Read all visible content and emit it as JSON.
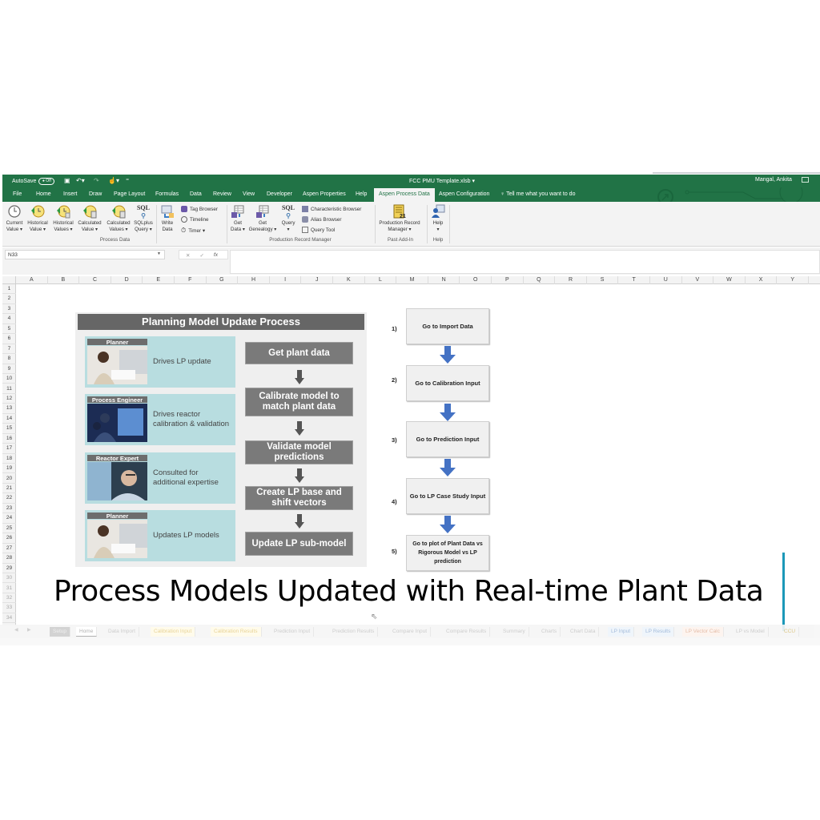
{
  "window": {
    "autosave_label": "AutoSave",
    "autosave_state": "Off",
    "document_title": "FCC PMU Template.xlsb",
    "user_name": "Mangal, Ankita"
  },
  "menu_tabs": [
    {
      "label": "File"
    },
    {
      "label": "Home"
    },
    {
      "label": "Insert"
    },
    {
      "label": "Draw"
    },
    {
      "label": "Page Layout"
    },
    {
      "label": "Formulas"
    },
    {
      "label": "Data"
    },
    {
      "label": "Review"
    },
    {
      "label": "View"
    },
    {
      "label": "Developer"
    },
    {
      "label": "Aspen Properties"
    },
    {
      "label": "Help"
    },
    {
      "label": "Aspen Process Data",
      "active": true
    },
    {
      "label": "Aspen Configuration"
    },
    {
      "label": "Tell me what you want to do"
    }
  ],
  "ribbon": {
    "process_data": {
      "group_label": "Process Data",
      "buttons": [
        {
          "line1": "Current",
          "line2": "Value ▾"
        },
        {
          "line1": "Historical",
          "line2": "Value ▾"
        },
        {
          "line1": "Historical",
          "line2": "Values ▾"
        },
        {
          "line1": "Calculated",
          "line2": "Value ▾"
        },
        {
          "line1": "Calculated",
          "line2": "Values ▾"
        },
        {
          "line1": "SQLplus",
          "line2": "Query ▾"
        },
        {
          "line1": "Write",
          "line2": "Data"
        }
      ],
      "small_buttons": [
        {
          "label": "Tag Browser"
        },
        {
          "label": "Timeline"
        },
        {
          "label": "Timer ▾"
        }
      ]
    },
    "production_record_manager": {
      "group_label": "Production Record Manager",
      "buttons": [
        {
          "line1": "Get",
          "line2": "Data ▾"
        },
        {
          "line1": "Get",
          "line2": "Genealogy ▾"
        },
        {
          "line1": "Query",
          "line2": "▾"
        }
      ],
      "small_buttons": [
        {
          "label": "Characteristic Browser"
        },
        {
          "label": "Alias Browser"
        },
        {
          "label": "Query Tool"
        }
      ]
    },
    "past_add_in": {
      "group_label": "Past Add-In",
      "button": {
        "line1": "Production Record",
        "line2": "Manager ▾"
      }
    },
    "help": {
      "group_label": "Help",
      "button": {
        "line1": "Help",
        "line2": "▾"
      }
    },
    "sql_icon_text": "SQL"
  },
  "formula_bar": {
    "name_box": "N33",
    "cancel_symbol": "✕",
    "enter_symbol": "✓",
    "fx_symbol": "fx",
    "formula_value": ""
  },
  "columns": [
    "A",
    "B",
    "C",
    "D",
    "E",
    "F",
    "G",
    "H",
    "I",
    "J",
    "K",
    "L",
    "M",
    "N",
    "O",
    "P",
    "Q",
    "R",
    "S",
    "T",
    "U",
    "V",
    "W",
    "X",
    "Y"
  ],
  "rows": [
    "1",
    "2",
    "3",
    "4",
    "5",
    "6",
    "7",
    "8",
    "9",
    "10",
    "11",
    "12",
    "13",
    "14",
    "15",
    "16",
    "17",
    "18",
    "19",
    "20",
    "21",
    "22",
    "23",
    "24",
    "25",
    "26",
    "27",
    "28",
    "29",
    "30",
    "31",
    "32",
    "33",
    "34"
  ],
  "planning": {
    "title": "Planning Model Update Process",
    "roles": [
      {
        "tag": "Planner",
        "description": "Drives LP update"
      },
      {
        "tag": "Process Engineer",
        "description": "Drives reactor calibration & validation"
      },
      {
        "tag": "Reactor Expert",
        "description": "Consulted for additional expertise"
      },
      {
        "tag": "Planner",
        "description": "Updates LP models"
      }
    ],
    "steps": [
      {
        "label": "Get plant data"
      },
      {
        "label": "Calibrate model to match plant data"
      },
      {
        "label": "Validate model predictions"
      },
      {
        "label": "Create LP base and shift vectors"
      },
      {
        "label": "Update LP sub-model"
      }
    ]
  },
  "navigation_flow": [
    {
      "number": "1)",
      "label": "Go to Import Data"
    },
    {
      "number": "2)",
      "label": "Go to Calibration Input"
    },
    {
      "number": "3)",
      "label": "Go to Prediction Input"
    },
    {
      "number": "4)",
      "label": "Go to LP Case Study Input"
    },
    {
      "number": "5)",
      "label": "Go to plot of Plant Data vs Rigorous Model vs LP prediction"
    }
  ],
  "caption": "Process Models Updated with Real-time Plant Data",
  "sheet_tabs": [
    {
      "label": "Setup"
    },
    {
      "label": "Home",
      "active": true
    },
    {
      "label": "Data Import"
    },
    {
      "label": "Calibration Input"
    },
    {
      "label": "Calibration Results"
    },
    {
      "label": "Prediction Input"
    },
    {
      "label": "Prediction Results"
    },
    {
      "label": "Compare Input"
    },
    {
      "label": "Compare Results"
    },
    {
      "label": "Summary"
    },
    {
      "label": "Charts"
    },
    {
      "label": "Chart Data"
    },
    {
      "label": "LP Input"
    },
    {
      "label": "LP Results"
    },
    {
      "label": "LP Vector Calc"
    },
    {
      "label": "LP vs Model"
    },
    {
      "label": "CCU"
    }
  ],
  "colors": {
    "excel_green": "#217346",
    "flow_arrow_blue": "#4472c4",
    "role_card_teal": "#b8dde0",
    "step_gray": "#7a7a7a",
    "cursor_line": "#1b98b8"
  }
}
